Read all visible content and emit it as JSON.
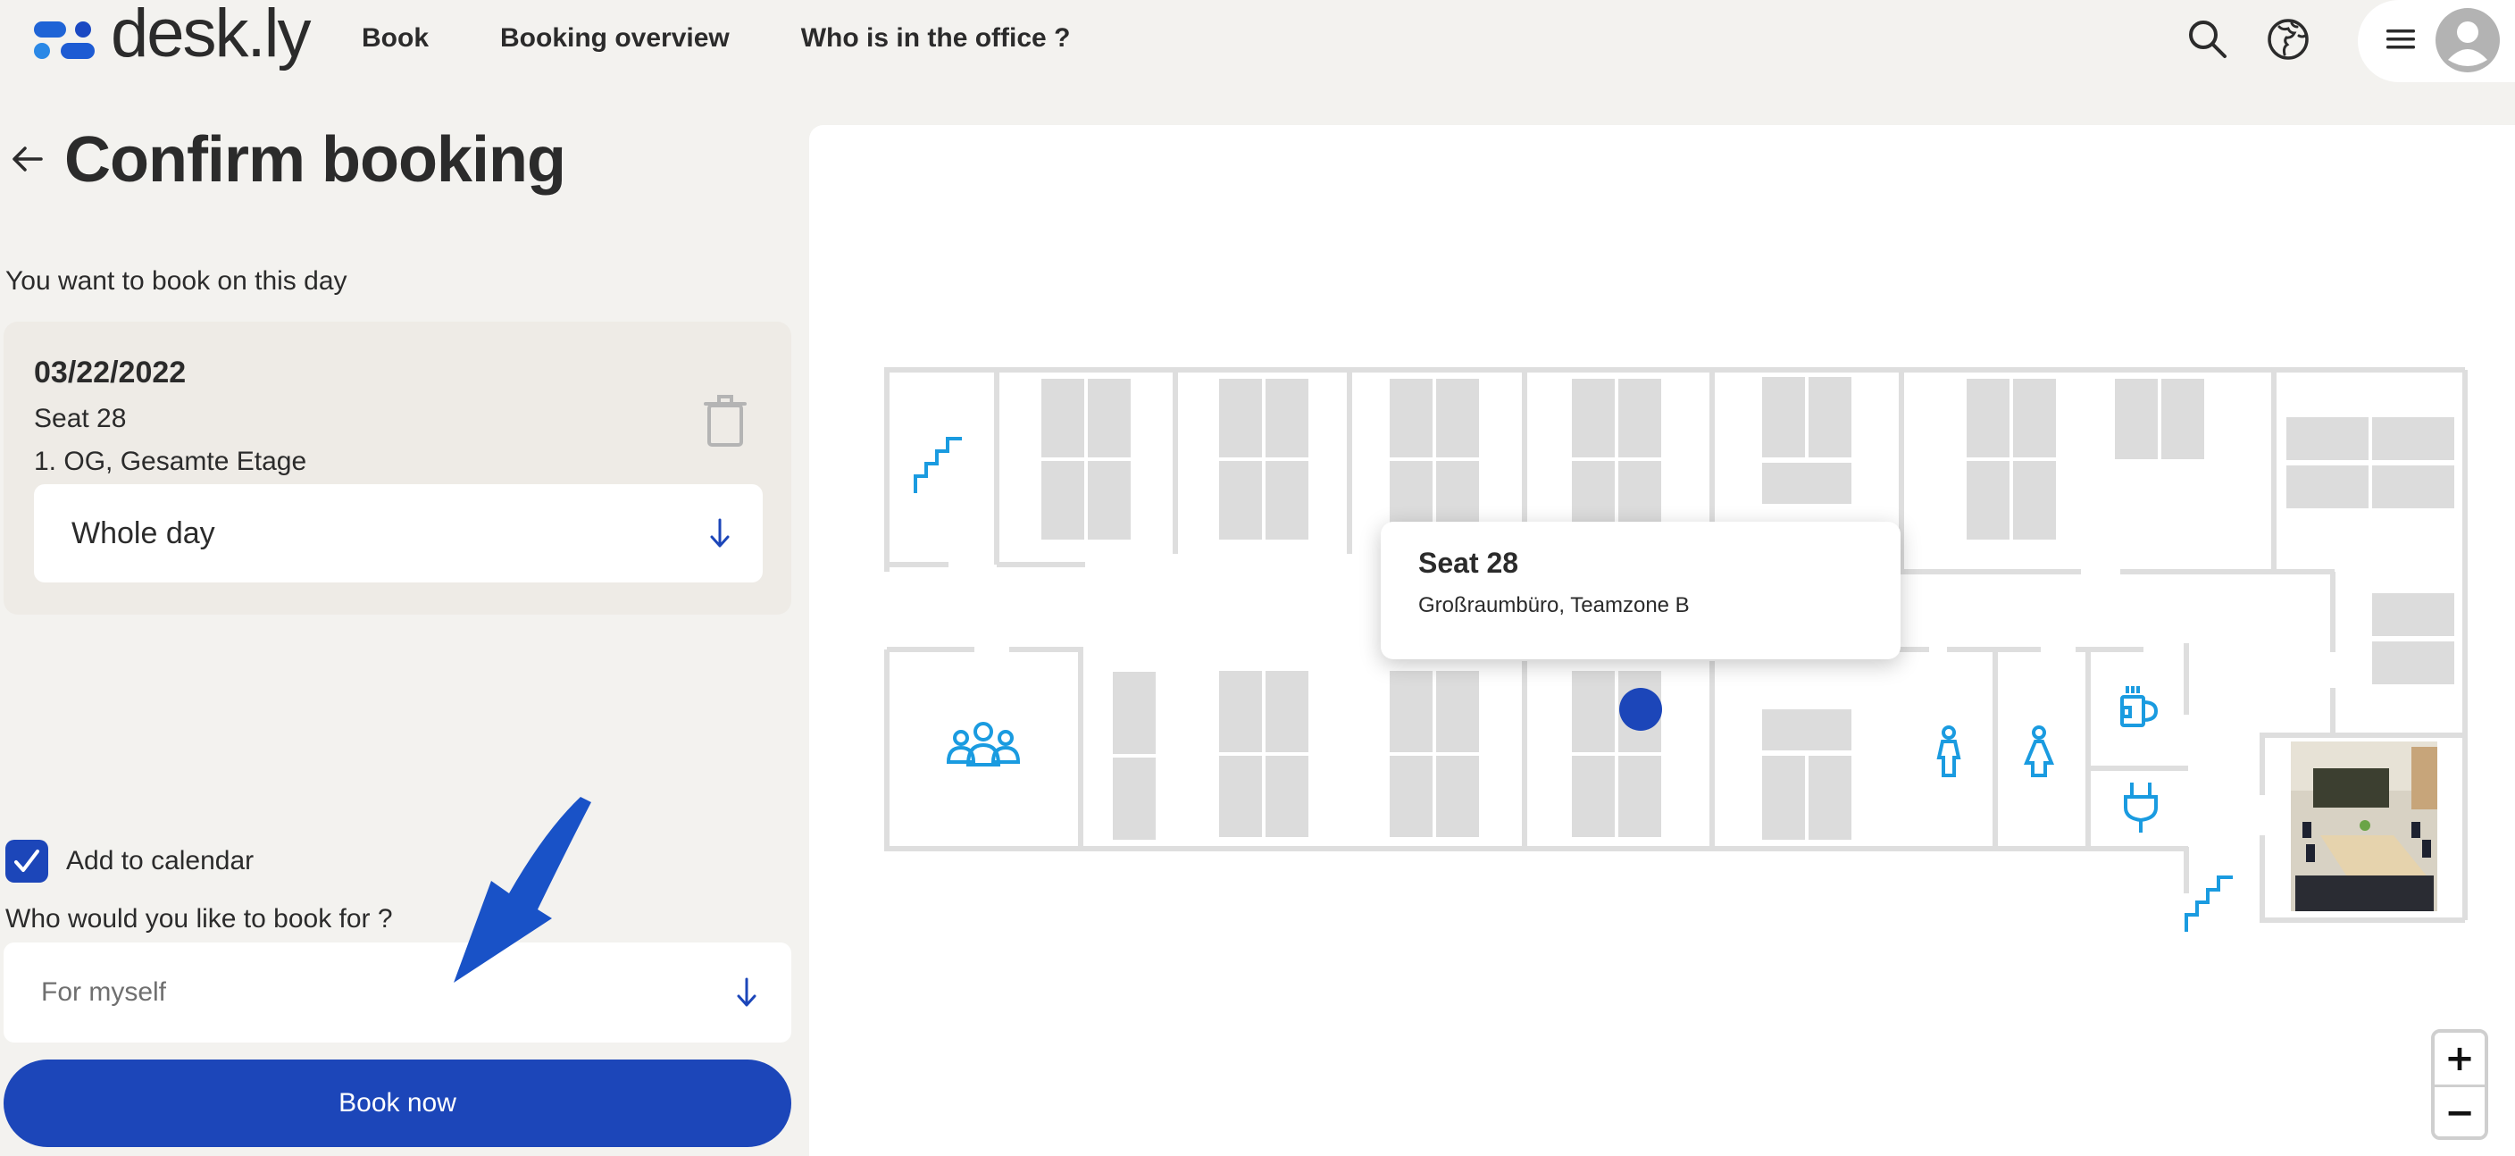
{
  "app": {
    "brand": "desk.ly",
    "nav": [
      {
        "label": "Book"
      },
      {
        "label": "Booking overview"
      },
      {
        "label": "Who is in the office ?"
      }
    ],
    "icons": [
      "search-icon",
      "globe-icon",
      "menu-icon",
      "avatar-icon"
    ]
  },
  "page": {
    "title": "Confirm booking",
    "subtitle": "You want to book on this day"
  },
  "booking": {
    "date": "03/22/2022",
    "seat": "Seat 28",
    "location": "1. OG, Gesamte Etage",
    "duration": {
      "selected": "Whole day"
    }
  },
  "options": {
    "add_to_calendar": {
      "label": "Add to calendar",
      "checked": true
    },
    "book_for": {
      "label": "Who would you like to book for ?",
      "selected": "For myself"
    }
  },
  "actions": {
    "book_now": "Book now"
  },
  "map": {
    "tooltip": {
      "title": "Seat 28",
      "subtitle": "Großraumbüro, Teamzone B"
    },
    "zoom_in": "+",
    "zoom_out": "−",
    "icons": [
      "stairs-icon",
      "meeting-room-icon",
      "male-restroom-icon",
      "female-restroom-icon",
      "coffee-icon",
      "power-plug-icon",
      "room-photo"
    ]
  },
  "colors": {
    "accent": "#1c46b9",
    "map_icon": "#1a9be0",
    "desk": "#dcdcdc",
    "wall": "#dedede",
    "background": "#f3f2ef"
  }
}
